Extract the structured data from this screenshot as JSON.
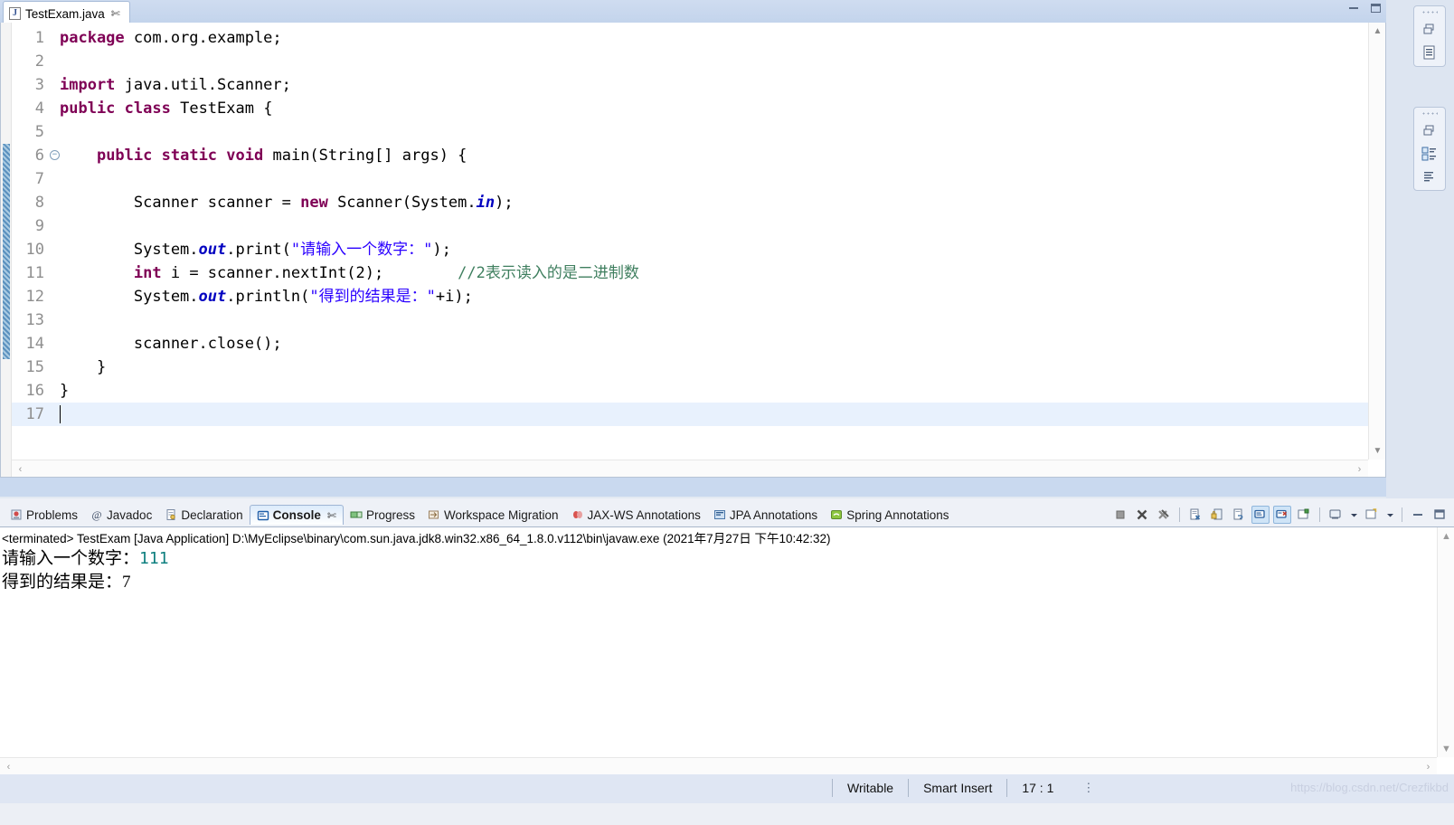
{
  "editor": {
    "tab": {
      "label": "TestExam.java",
      "close_glyph": "✄",
      "icon": "java-file-icon"
    },
    "window_controls": {
      "minimize": "minimize-icon",
      "maximize": "maximize-icon"
    },
    "current_line": 17,
    "fold_marker_line": 6,
    "lines": [
      {
        "n": "1",
        "html": "<span class='kw'>package</span> com.org.example;"
      },
      {
        "n": "2",
        "html": ""
      },
      {
        "n": "3",
        "html": "<span class='kw'>import</span> java.util.Scanner;"
      },
      {
        "n": "4",
        "html": "<span class='kw'>public</span> <span class='kw'>class</span> TestExam {"
      },
      {
        "n": "5",
        "html": ""
      },
      {
        "n": "6",
        "html": "    <span class='kw'>public</span> <span class='kw'>static</span> <span class='kw'>void</span> main(String[] args) {"
      },
      {
        "n": "7",
        "html": ""
      },
      {
        "n": "8",
        "html": "        Scanner scanner = <span class='kw'>new</span> Scanner(System.<span class='fld'>in</span>);"
      },
      {
        "n": "9",
        "html": ""
      },
      {
        "n": "10",
        "html": "        System.<span class='fld'>out</span>.print(<span class='str'>\"请输入一个数字：\"</span>);"
      },
      {
        "n": "11",
        "html": "        <span class='kw'>int</span> i = scanner.nextInt(2);        <span class='cmt'>//2表示读入的是二进制数</span>"
      },
      {
        "n": "12",
        "html": "        System.<span class='fld'>out</span>.println(<span class='str'>\"得到的结果是：\"</span>+i);"
      },
      {
        "n": "13",
        "html": ""
      },
      {
        "n": "14",
        "html": "        scanner.close();"
      },
      {
        "n": "15",
        "html": "    }"
      },
      {
        "n": "16",
        "html": "}"
      },
      {
        "n": "17",
        "html": ""
      }
    ],
    "plain_text": "package com.org.example;\n\nimport java.util.Scanner;\npublic class TestExam {\n\n    public static void main(String[] args) {\n\n        Scanner scanner = new Scanner(System.in);\n\n        System.out.print(\"请输入一个数字：\");\n        int i = scanner.nextInt(2);        //2表示读入的是二进制数\n        System.out.println(\"得到的结果是：\"+i);\n\n        scanner.close();\n    }\n}\n"
  },
  "bottom_panel": {
    "tabs": [
      {
        "label": "Problems",
        "icon": "problems-icon",
        "active": false
      },
      {
        "label": "Javadoc",
        "icon": "javadoc-at-icon",
        "active": false
      },
      {
        "label": "Declaration",
        "icon": "declaration-icon",
        "active": false
      },
      {
        "label": "Console",
        "icon": "console-icon",
        "active": true
      },
      {
        "label": "Progress",
        "icon": "progress-icon",
        "active": false
      },
      {
        "label": "Workspace Migration",
        "icon": "workspace-migration-icon",
        "active": false
      },
      {
        "label": "JAX-WS Annotations",
        "icon": "jaxws-annotations-icon",
        "active": false
      },
      {
        "label": "JPA Annotations",
        "icon": "jpa-annotations-icon",
        "active": false
      },
      {
        "label": "Spring Annotations",
        "icon": "spring-annotations-icon",
        "active": false
      }
    ],
    "active_tab_close_glyph": "✄",
    "toolbar": [
      {
        "name": "terminate-button",
        "glyph": "■",
        "toggled": false
      },
      {
        "name": "remove-launch-button",
        "glyph": "✖",
        "toggled": false
      },
      {
        "name": "remove-all-terminated-button",
        "glyph": "✖",
        "toggled": false
      },
      {
        "name": "clear-console-button",
        "glyph": "▤",
        "toggled": false
      },
      {
        "name": "scroll-lock-button",
        "glyph": "▤",
        "toggled": false
      },
      {
        "name": "word-wrap-button",
        "glyph": "▤",
        "toggled": false
      },
      {
        "name": "show-console-stdout-button",
        "glyph": "▤",
        "toggled": true
      },
      {
        "name": "show-console-stderr-button",
        "glyph": "▤",
        "toggled": true
      },
      {
        "name": "pin-console-button",
        "glyph": "▣",
        "toggled": false
      },
      {
        "name": "display-selected-console-button",
        "glyph": "▤",
        "toggled": false
      },
      {
        "name": "open-console-button",
        "glyph": "▣",
        "toggled": false
      },
      {
        "name": "minimize-view-button",
        "glyph": "—",
        "toggled": false
      },
      {
        "name": "maximize-view-button",
        "glyph": "▭",
        "toggled": false
      }
    ],
    "console": {
      "header": "<terminated> TestExam [Java Application] D:\\MyEclipse\\binary\\com.sun.java.jdk8.win32.x86_64_1.8.0.v112\\bin\\javaw.exe (2021年7月27日 下午10:42:32)",
      "output_lines": [
        {
          "prompt": "请输入一个数字：",
          "value": "111"
        },
        {
          "prompt": "得到的结果是：7",
          "value": ""
        }
      ]
    }
  },
  "right_rail": {
    "stacks": [
      {
        "name": "restore-stack-1",
        "icons": [
          "restore-icon",
          "outline-icon"
        ]
      },
      {
        "name": "restore-stack-2",
        "icons": [
          "restore-icon",
          "package-explorer-icon",
          "task-list-icon"
        ]
      }
    ]
  },
  "status_bar": {
    "writable": "Writable",
    "insert_mode": "Smart Insert",
    "cursor_position": "17 : 1",
    "overflow_glyph": "⋮",
    "watermark": "https://blog.csdn.net/Crezfikbd"
  },
  "colors": {
    "keyword": "#7f0055",
    "string": "#2a00ff",
    "comment": "#3f7f5f",
    "field": "#0000c0",
    "console_value": "#108080",
    "tab_active_bg": "#ffffff",
    "chrome": "#c9d9ef"
  }
}
